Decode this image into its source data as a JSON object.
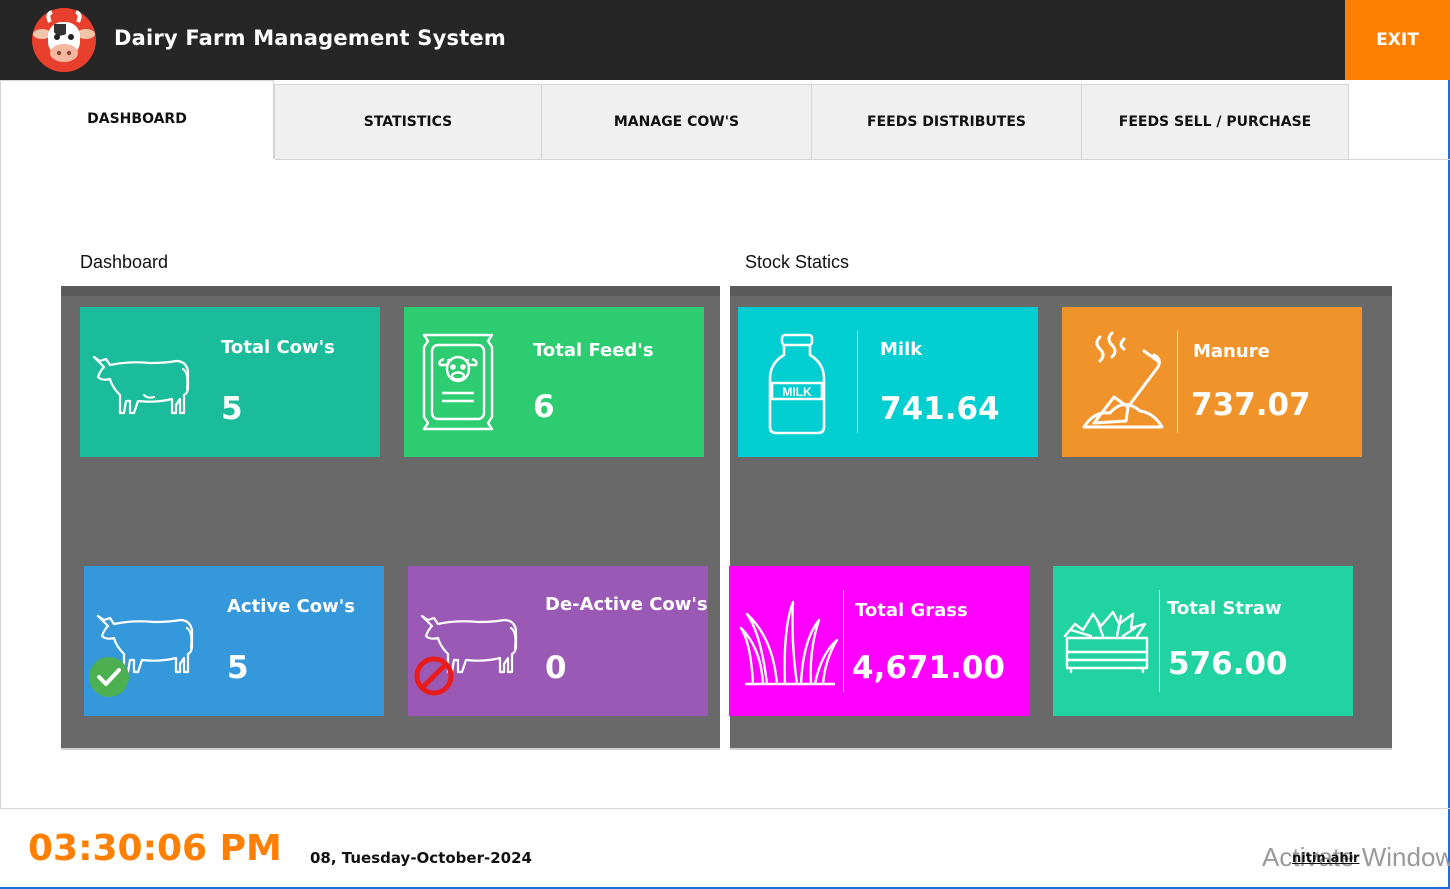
{
  "app": {
    "title": "Dairy Farm Management System",
    "exit_label": "EXIT"
  },
  "tabs": [
    {
      "label": "DASHBOARD",
      "active": true
    },
    {
      "label": "STATISTICS"
    },
    {
      "label": "MANAGE COW'S"
    },
    {
      "label": "FEEDS DISTRIBUTES"
    },
    {
      "label": "FEEDS SELL  /  PURCHASE"
    }
  ],
  "dashboard": {
    "label": "Dashboard",
    "cards": [
      {
        "title": "Total Cow's",
        "value": "5",
        "color": "#1abc9c",
        "icon": "cow-icon"
      },
      {
        "title": "Total Feed's",
        "value": "6",
        "color": "#2ecc71",
        "icon": "feed-bag-icon"
      },
      {
        "title": "Active Cow's",
        "value": "5",
        "color": "#3498db",
        "icon": "active-cow-icon"
      },
      {
        "title": "De-Active Cow's",
        "value": "0",
        "color": "#9b59b6",
        "icon": "inactive-cow-icon"
      }
    ]
  },
  "stock": {
    "label": "Stock Statics",
    "cards": [
      {
        "title": "Milk",
        "value": "741.64",
        "color": "#00ced1",
        "icon": "milk-bottle-icon"
      },
      {
        "title": "Manure",
        "value": "737.07",
        "color": "#f0932b",
        "icon": "manure-shovel-icon"
      },
      {
        "title": "Total Grass",
        "value": "4,671.00",
        "color": "#ff00ff",
        "icon": "grass-icon"
      },
      {
        "title": "Total Straw",
        "value": "576.00",
        "color": "#20d3a0",
        "icon": "straw-crate-icon"
      }
    ]
  },
  "footer": {
    "time": "03:30:06 PM",
    "date": "08, Tuesday-October-2024",
    "user": "nitin.ahir",
    "watermark": "Activate Windows"
  }
}
